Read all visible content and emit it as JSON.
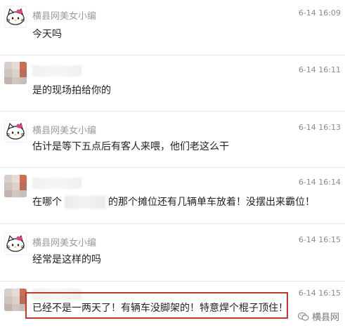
{
  "messages": [
    {
      "sender": "横县网美女小编",
      "time": "6-14 16:09",
      "text": "今天吗"
    },
    {
      "sender": "",
      "time": "6-14 16:11",
      "text": "是的现场拍给你的"
    },
    {
      "sender": "横县网美女小编",
      "time": "6-14 16:13",
      "text": "估计是等下五点后有客人来喂，他们老这么干"
    },
    {
      "sender": "",
      "time": "6-14 16:14",
      "text_before": "在哪个",
      "text_after": "的那个摊位还有几辆单车放着！没摆出来霸位！"
    },
    {
      "sender": "横县网美女小编",
      "time": "6-14 16:15",
      "text": "经常是这样的吗"
    },
    {
      "sender": "",
      "time": "6-14 16:15",
      "text": "已经不是一两天了！有辆车没脚架的！特意焊个棍子顶住！"
    }
  ],
  "watermark": "横县网",
  "colors": {
    "highlight_border": "#c0392b",
    "name_gray": "#9a9a9a",
    "text": "#222222"
  },
  "icons": {
    "kitty_avatar": "hello-kitty-avatar",
    "pixel_avatar": "pixelated-avatar",
    "watermark": "wechat-icon"
  }
}
